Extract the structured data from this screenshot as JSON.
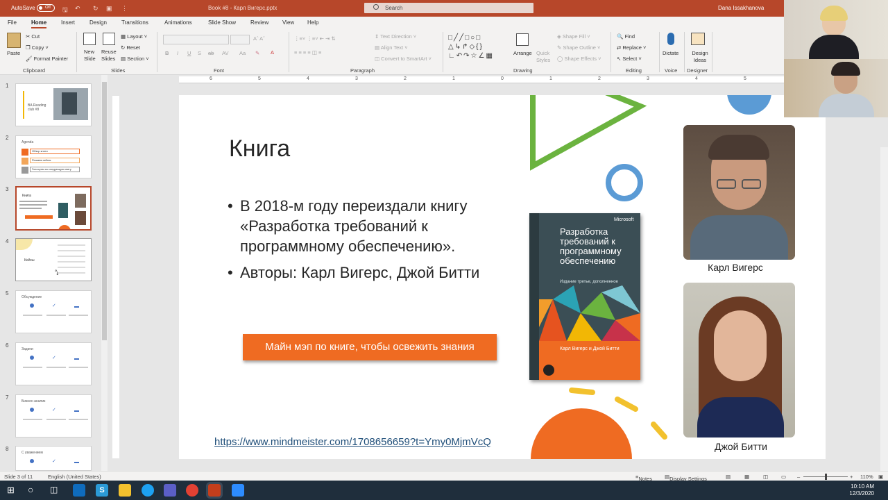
{
  "titlebar": {
    "autosave_label": "AutoSave",
    "autosave_state": "Off",
    "document_title": "Book #8 - Карл Вигерс.pptx",
    "search_placeholder": "Search",
    "user_name": "Dana Issakhanova"
  },
  "menu_tabs": [
    "File",
    "Home",
    "Insert",
    "Design",
    "Transitions",
    "Animations",
    "Slide Show",
    "Review",
    "View",
    "Help"
  ],
  "ribbon": {
    "clipboard": {
      "group": "Clipboard",
      "paste": "Paste",
      "cut": "Cut",
      "copy": "Copy",
      "format_painter": "Format Painter"
    },
    "slides": {
      "group": "Slides",
      "new_slide": "New Slide",
      "reuse_slides": "Reuse Slides",
      "layout": "Layout",
      "reset": "Reset",
      "section": "Section"
    },
    "font": {
      "group": "Font"
    },
    "paragraph": {
      "group": "Paragraph",
      "text_direction": "Text Direction",
      "align_text": "Align Text",
      "convert_smartart": "Convert to SmartArt"
    },
    "drawing": {
      "group": "Drawing",
      "arrange": "Arrange",
      "quick_styles": "Quick Styles",
      "shape_fill": "Shape Fill",
      "shape_outline": "Shape Outline",
      "shape_effects": "Shape Effects"
    },
    "editing": {
      "group": "Editing",
      "find": "Find",
      "replace": "Replace",
      "select": "Select"
    },
    "voice": {
      "group": "Voice",
      "dictate": "Dictate"
    },
    "designer": {
      "group": "Designer",
      "design_ideas": "Design Ideas"
    }
  },
  "thumbnails": [
    {
      "num": "1",
      "text": "BA Reading club #8"
    },
    {
      "num": "2",
      "text": "Agenda"
    },
    {
      "num": "3",
      "text": "Книга"
    },
    {
      "num": "4",
      "text": "Кейсы"
    },
    {
      "num": "5",
      "text": "Обсуждение"
    },
    {
      "num": "6",
      "text": "Задачи"
    },
    {
      "num": "7",
      "text": "Бизнес-анализ"
    },
    {
      "num": "8",
      "text": "С уважением"
    }
  ],
  "thumb2_items": [
    "Обзор книги",
    "Решаем кейсы",
    "Голосуем за следующую книгу"
  ],
  "slide": {
    "title": "Книга",
    "bullets": [
      "В 2018-м году переиздали книгу «Разработка требований к программному обеспечению».",
      "Авторы: Карл Вигерс, Джой Битти"
    ],
    "button_label": "Майн мэп по книге, чтобы освежить знания",
    "link_text": "https://www.mindmeister.com/1708656659?t=Ymy0MjmVcQ",
    "book": {
      "brand": "Microsoft",
      "title": "Разработка требований к программному обеспечению",
      "edition": "Издание третье, дополненное",
      "authors": "Карл Вигерс и Джой Битти"
    },
    "author1_caption": "Карл Вигерс",
    "author2_caption": "Джой Битти"
  },
  "ruler_marks": [
    "6",
    "5",
    "4",
    "3",
    "2",
    "1",
    "0",
    "1",
    "2",
    "3",
    "4",
    "5",
    "6"
  ],
  "statusbar": {
    "slide_info": "Slide 3 of 11",
    "language": "English (United States)",
    "notes": "Notes",
    "display_settings": "Display Settings",
    "zoom": "110%"
  },
  "clock": {
    "time": "10:10 AM",
    "date": "12/3/2020"
  },
  "colors": {
    "accent": "#b7472a",
    "button": "#ef6b22",
    "link": "#1f4e79"
  }
}
